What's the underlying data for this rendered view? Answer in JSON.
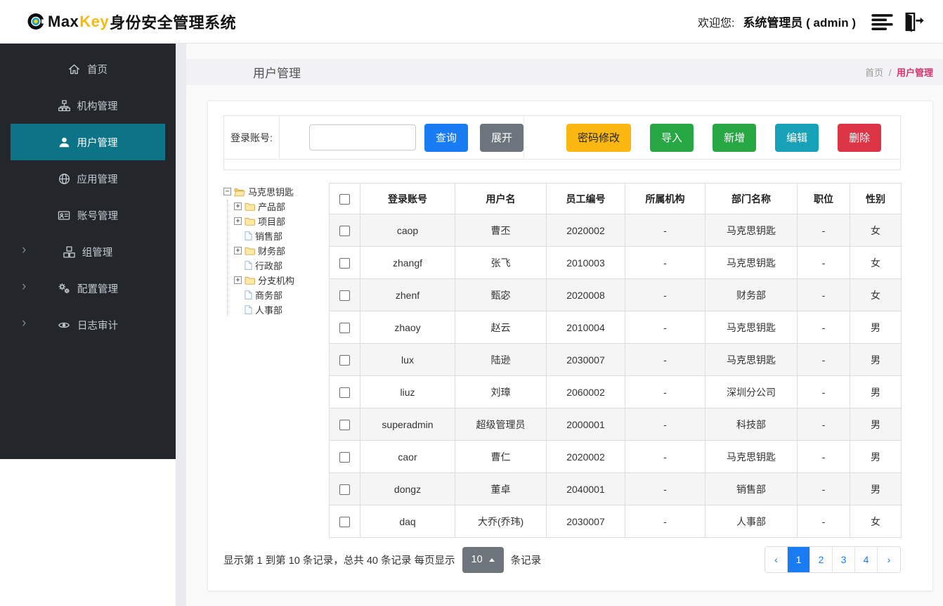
{
  "header": {
    "logo": {
      "max": "Max",
      "key": "Key",
      "suffix": "身份安全管理系统"
    },
    "welcome_label": "欢迎您:",
    "user": "系统管理员 ( admin )",
    "icons": [
      "menu-icon",
      "logout-icon"
    ]
  },
  "sidebar": {
    "items": [
      {
        "label": "首页",
        "icon": "home-icon",
        "active": false,
        "has_chevron": false
      },
      {
        "label": "机构管理",
        "icon": "sitemap-icon",
        "active": false,
        "has_chevron": false
      },
      {
        "label": "用户管理",
        "icon": "user-icon",
        "active": true,
        "has_chevron": false
      },
      {
        "label": "应用管理",
        "icon": "globe-icon",
        "active": false,
        "has_chevron": false
      },
      {
        "label": "账号管理",
        "icon": "id-card-icon",
        "active": false,
        "has_chevron": false
      },
      {
        "label": "组管理",
        "icon": "cubes-icon",
        "active": false,
        "has_chevron": true
      },
      {
        "label": "配置管理",
        "icon": "gears-icon",
        "active": false,
        "has_chevron": true
      },
      {
        "label": "日志审计",
        "icon": "eye-icon",
        "active": false,
        "has_chevron": true
      }
    ]
  },
  "page": {
    "title": "用户管理",
    "breadcrumb": {
      "home": "首页",
      "separator": "/",
      "current": "用户管理"
    }
  },
  "search": {
    "label": "登录账号:",
    "input_value": "",
    "query_button": "查询",
    "expand_button": "展开",
    "actions": [
      {
        "label": "密码修改",
        "bg": "#fcb810",
        "fg": "#212529"
      },
      {
        "label": "导入",
        "bg": "#28a745",
        "fg": "#ffffff"
      },
      {
        "label": "新增",
        "bg": "#28a745",
        "fg": "#ffffff"
      },
      {
        "label": "编辑",
        "bg": "#17a2b8",
        "fg": "#ffffff"
      },
      {
        "label": "删除",
        "bg": "#dc3545",
        "fg": "#ffffff"
      }
    ]
  },
  "tree": {
    "root": {
      "label": "马克思钥匙",
      "expander": "-",
      "icon": "open-folder-icon"
    },
    "children": [
      {
        "label": "产品部",
        "type": "branch"
      },
      {
        "label": "项目部",
        "type": "branch"
      },
      {
        "label": "销售部",
        "type": "leaf"
      },
      {
        "label": "财务部",
        "type": "branch"
      },
      {
        "label": "行政部",
        "type": "leaf"
      },
      {
        "label": "分支机构",
        "type": "branch"
      },
      {
        "label": "商务部",
        "type": "leaf"
      },
      {
        "label": "人事部",
        "type": "leaf"
      }
    ]
  },
  "table": {
    "columns": [
      "登录账号",
      "用户名",
      "员工编号",
      "所属机构",
      "部门名称",
      "职位",
      "性别"
    ],
    "rows": [
      {
        "login": "caop",
        "name": "曹丕",
        "emp": "2020002",
        "org": "-",
        "dept": "马克思钥匙",
        "pos": "-",
        "gender": "女"
      },
      {
        "login": "zhangf",
        "name": "张飞",
        "emp": "2010003",
        "org": "-",
        "dept": "马克思钥匙",
        "pos": "-",
        "gender": "女"
      },
      {
        "login": "zhenf",
        "name": "甄宓",
        "emp": "2020008",
        "org": "-",
        "dept": "财务部",
        "pos": "-",
        "gender": "女"
      },
      {
        "login": "zhaoy",
        "name": "赵云",
        "emp": "2010004",
        "org": "-",
        "dept": "马克思钥匙",
        "pos": "-",
        "gender": "男"
      },
      {
        "login": "lux",
        "name": "陆逊",
        "emp": "2030007",
        "org": "-",
        "dept": "马克思钥匙",
        "pos": "-",
        "gender": "男"
      },
      {
        "login": "liuz",
        "name": "刘璋",
        "emp": "2060002",
        "org": "-",
        "dept": "深圳分公司",
        "pos": "-",
        "gender": "男"
      },
      {
        "login": "superadmin",
        "name": "超级管理员",
        "emp": "2000001",
        "org": "-",
        "dept": "科技部",
        "pos": "-",
        "gender": "男"
      },
      {
        "login": "caor",
        "name": "曹仁",
        "emp": "2020002",
        "org": "-",
        "dept": "马克思钥匙",
        "pos": "-",
        "gender": "男"
      },
      {
        "login": "dongz",
        "name": "董卓",
        "emp": "2040001",
        "org": "-",
        "dept": "销售部",
        "pos": "-",
        "gender": "男"
      },
      {
        "login": "daq",
        "name": "大乔(乔玮)",
        "emp": "2030007",
        "org": "-",
        "dept": "人事部",
        "pos": "-",
        "gender": "女"
      }
    ]
  },
  "footer": {
    "summary_prefix": "显示第 1 到第 10 条记录，总共 40 条记录 每页显示",
    "page_size": "10",
    "summary_suffix": "条记录",
    "pagination": {
      "items": [
        "‹",
        "1",
        "2",
        "3",
        "4",
        "›"
      ],
      "active": "1"
    }
  },
  "colors": {
    "sidebar_bg": "#23272b",
    "active_item_teal": "#0d7386",
    "primary_blue": "#1a7cf3",
    "secondary_gray": "#6c757d",
    "warning_yellow": "#fcb810",
    "success_green": "#28a745",
    "info_teal": "#17a2b8",
    "danger_red": "#dc3545",
    "breadcrumb_pink": "#d6336c",
    "logo_yellow": "#f5bb0c"
  }
}
